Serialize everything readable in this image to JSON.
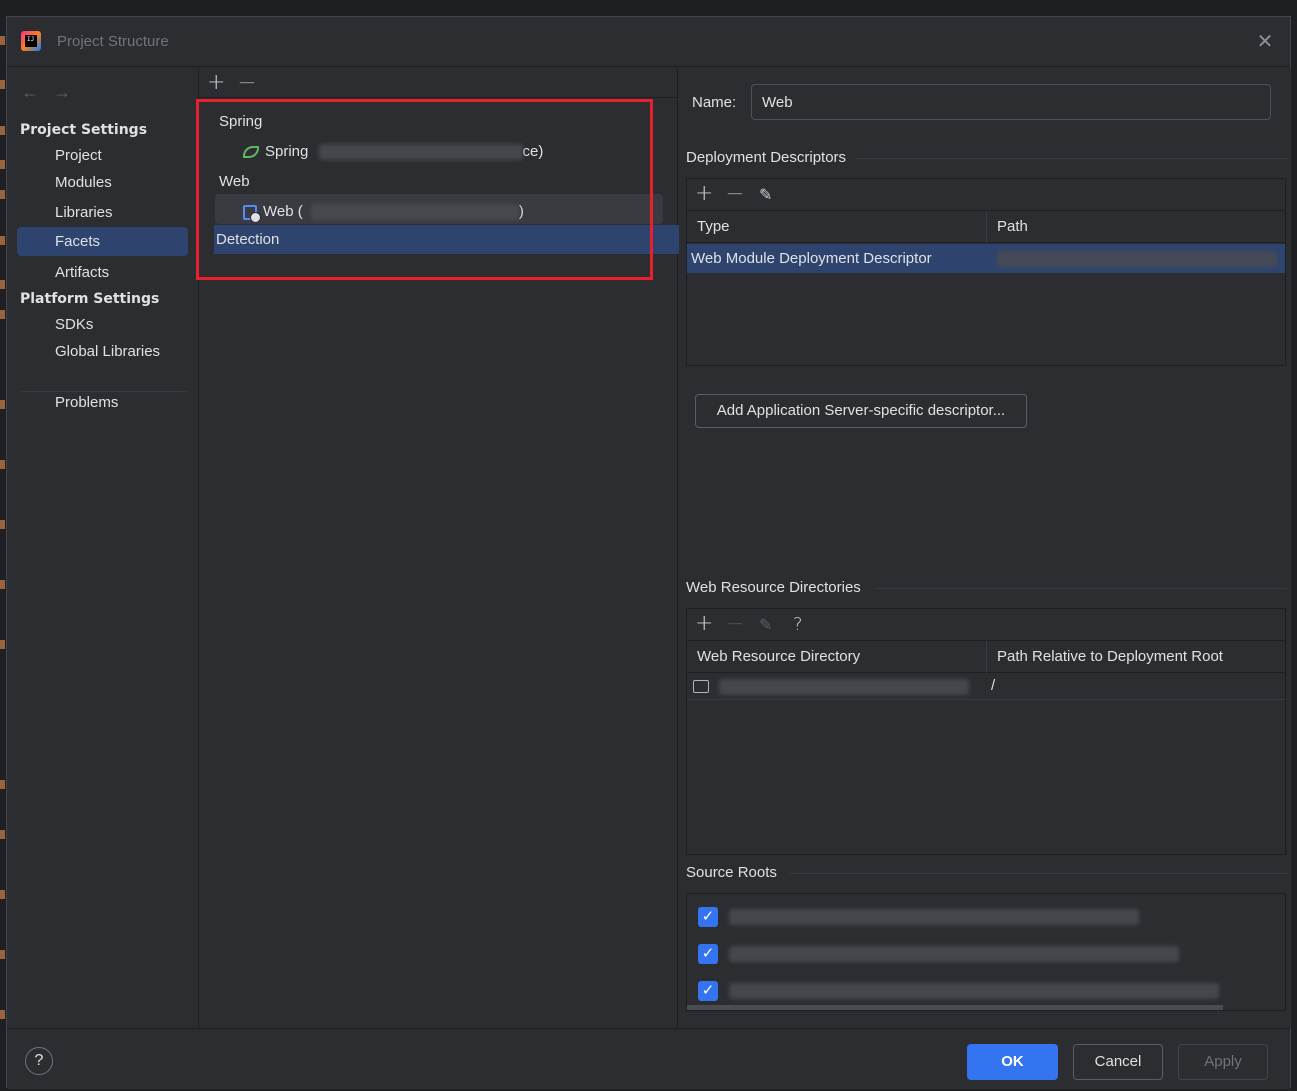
{
  "window": {
    "title": "Project Structure",
    "close_icon": "close-icon"
  },
  "sidebar": {
    "nav": {
      "back": "←",
      "forward": "→"
    },
    "sections": [
      {
        "label": "Project Settings"
      },
      {
        "label": "Platform Settings"
      }
    ],
    "items": [
      {
        "label": "Project"
      },
      {
        "label": "Modules"
      },
      {
        "label": "Libraries"
      },
      {
        "label": "Facets",
        "selected": true
      },
      {
        "label": "Artifacts"
      },
      {
        "label": "SDKs"
      },
      {
        "label": "Global Libraries"
      },
      {
        "label": "Problems"
      }
    ]
  },
  "facets": {
    "toolbar": {
      "add": "+",
      "remove": "—"
    },
    "tree": [
      {
        "label": "Spring",
        "type": "group"
      },
      {
        "label": "Spring",
        "suffix": "ce)",
        "icon": "spring-leaf-icon"
      },
      {
        "label": "Web",
        "type": "group"
      },
      {
        "label": "Web (",
        "suffix": ")",
        "icon": "web-module-icon"
      },
      {
        "label": "Detection",
        "selected": true
      }
    ],
    "highlight_color": "#e8202e"
  },
  "details": {
    "name_label": "Name:",
    "name_value": "Web",
    "deployment": {
      "title": "Deployment Descriptors",
      "toolbar": {
        "add": "+",
        "remove": "—",
        "edit": "✎"
      },
      "columns": [
        "Type",
        "Path"
      ],
      "rows": [
        {
          "type": "Web Module Deployment Descriptor"
        }
      ],
      "add_server_button": "Add Application Server-specific descriptor..."
    },
    "web_resources": {
      "title": "Web Resource Directories",
      "toolbar": {
        "add": "+",
        "remove": "—",
        "edit": "✎",
        "help": "?"
      },
      "columns": [
        "Web Resource Directory",
        "Path Relative to Deployment Root"
      ],
      "rows": [
        {
          "path": "/"
        }
      ]
    },
    "source_roots": {
      "title": "Source Roots",
      "items": [
        {
          "checked": true
        },
        {
          "checked": true
        },
        {
          "checked": true
        }
      ]
    }
  },
  "footer": {
    "help": "?",
    "ok": "OK",
    "cancel": "Cancel",
    "apply": "Apply"
  },
  "colors": {
    "accent": "#3574f0",
    "selection": "#2e436e",
    "background": "#2b2d30"
  }
}
